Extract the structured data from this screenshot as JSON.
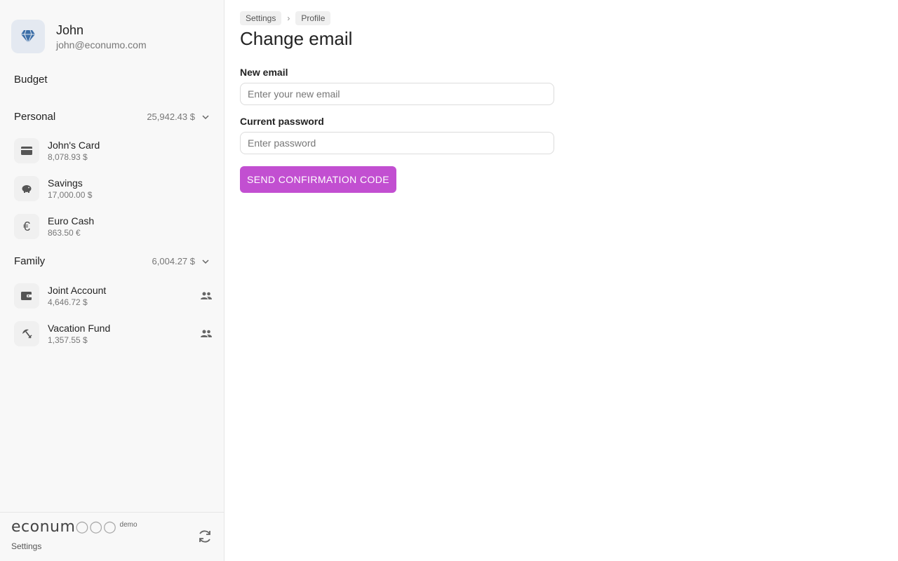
{
  "user": {
    "name": "John",
    "email": "john@econumo.com"
  },
  "sidebar": {
    "budget_label": "Budget",
    "groups": [
      {
        "title": "Personal",
        "total": "25,942.43 $",
        "accounts": [
          {
            "name": "John's Card",
            "balance": "8,078.93 $",
            "icon": "credit-card-icon",
            "shared": false
          },
          {
            "name": "Savings",
            "balance": "17,000.00 $",
            "icon": "piggy-bank-icon",
            "shared": false
          },
          {
            "name": "Euro Cash",
            "balance": "863.50 €",
            "icon": "euro-icon",
            "shared": false
          }
        ]
      },
      {
        "title": "Family",
        "total": "6,004.27 $",
        "accounts": [
          {
            "name": "Joint Account",
            "balance": "4,646.72 $",
            "icon": "wallet-icon",
            "shared": true
          },
          {
            "name": "Vacation Fund",
            "balance": "1,357.55 $",
            "icon": "beach-umbrella-icon",
            "shared": true
          }
        ]
      }
    ],
    "footer": {
      "logo_text": "econum",
      "demo_label": "demo",
      "settings_label": "Settings"
    }
  },
  "breadcrumb": [
    "Settings",
    "Profile"
  ],
  "page_title": "Change email",
  "form": {
    "new_email": {
      "label": "New email",
      "placeholder": "Enter your new email",
      "value": ""
    },
    "current_password": {
      "label": "Current password",
      "placeholder": "Enter password",
      "value": ""
    },
    "submit_label": "SEND CONFIRMATION CODE"
  },
  "colors": {
    "accent": "#c24fd1",
    "sidebar_bg": "#f8f8f8",
    "avatar_bg": "#e4e9f1",
    "avatar_icon": "#3d6fa8"
  }
}
